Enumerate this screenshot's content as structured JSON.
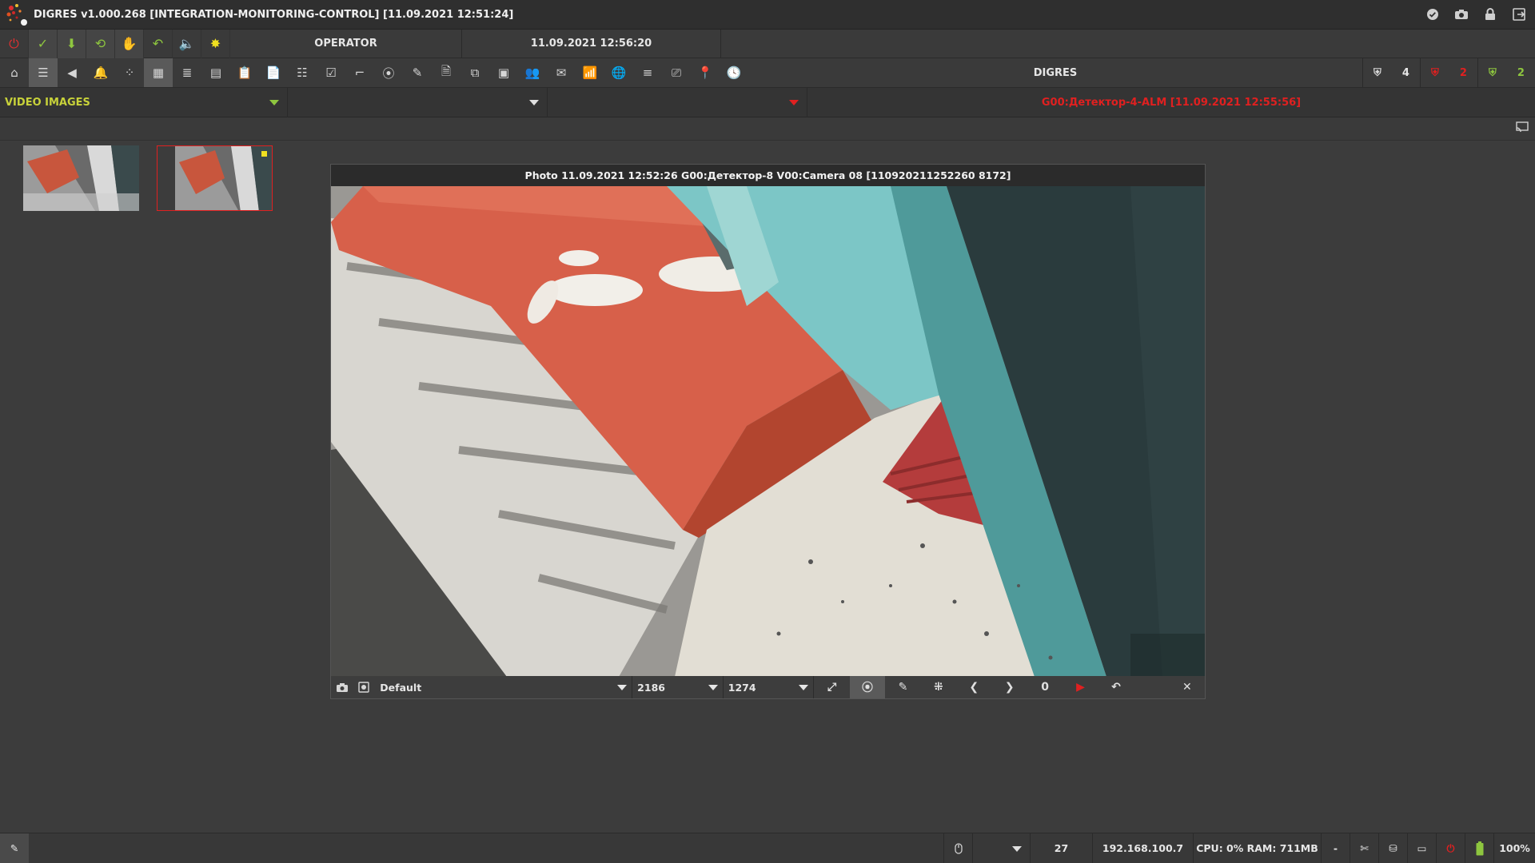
{
  "titlebar": {
    "title": "DIGRES v1.000.268 [INTEGRATION-MONITORING-CONTROL] [11.09.2021 12:51:24]"
  },
  "toolbar1": {
    "role": "OPERATOR",
    "datetime": "11.09.2021 12:56:20"
  },
  "toolbar2": {
    "center_label": "DIGRES",
    "counters": [
      {
        "icon": "shield-icon",
        "value": "4",
        "color": "#d8d8d8"
      },
      {
        "icon": "red-shield-icon",
        "value": "2",
        "color": "#e02020"
      },
      {
        "icon": "green-shield-icon",
        "value": "2",
        "color": "#8ec63f"
      }
    ]
  },
  "filterbar": {
    "category": "VIDEO IMAGES",
    "alarm": "G00:Детектор-4-ALM [11.09.2021 12:55:56]"
  },
  "viewer": {
    "caption": "Photo 11.09.2021 12:52:26 G00:Детектор-8 V00:Camera 08 [110920211252260 8172]",
    "preset": "Default",
    "width": "2186",
    "height": "1274",
    "frame": "0"
  },
  "statusbar": {
    "count": "27",
    "ip": "192.168.100.7",
    "cpu_ram": "CPU: 0% RAM: 711MB",
    "dash": "-",
    "battery": "100%"
  },
  "colors": {
    "accent_green": "#8ec63f",
    "alarm_red": "#e02020",
    "category_yellow": "#c8d23a"
  }
}
